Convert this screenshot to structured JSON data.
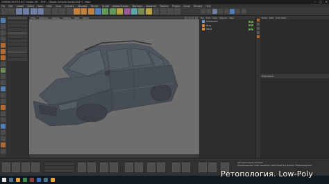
{
  "window": {
    "title": "CINEMA 4D R19.027 Studio (RC - R19) - [Skoda Octavia Combi.c4d *] - Main",
    "controls": [
      "–",
      "□",
      "✕"
    ]
  },
  "menu": {
    "items": [
      "File",
      "Edit",
      "Create",
      "Select",
      "Tools",
      "Mesh",
      "Snap",
      "Animate",
      "Simulate",
      "Render",
      "Sculpt",
      "Motion Tracker",
      "MoGraph",
      "Character",
      "Pipeline",
      "Plugins",
      "Script",
      "Window",
      "Help"
    ]
  },
  "viewport": {
    "menu": [
      "View",
      "Cameras",
      "Display",
      "Options",
      "Filter",
      "Panel"
    ]
  },
  "object_manager": {
    "menu": [
      "File",
      "Edit",
      "View",
      "Objects",
      "Tags"
    ],
    "objects": [
      {
        "name": "Subdivision",
        "icon": "subdivision-icon"
      },
      {
        "name": "Body",
        "icon": "polygon-object-icon"
      },
      {
        "name": "Plane",
        "icon": "plane-icon"
      }
    ]
  },
  "attribute_manager": {
    "menu": [
      "Mode",
      "Edit",
      "User Data"
    ],
    "section": "Подсказки"
  },
  "status": {
    "line1": "Автоматически Mindsel",
    "line2": "Перемещение: Клик мышкой; перетащить в режим \"Перемещение\""
  },
  "overlay": {
    "caption": "Ретопология. Low-Poly"
  },
  "colors": {
    "viewport_bg": "#6e6e6e",
    "car_body": "#4a5059",
    "accent_orange": "#d28a3a"
  }
}
